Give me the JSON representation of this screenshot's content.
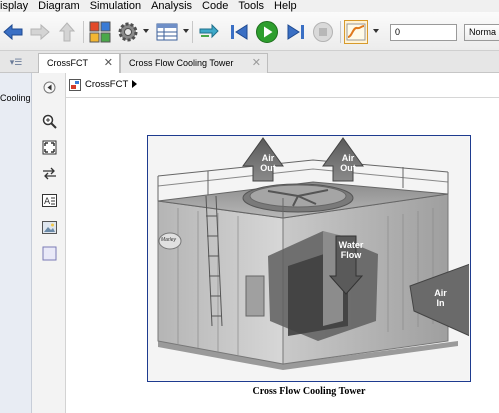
{
  "menu": [
    "isplay",
    "Diagram",
    "Simulation",
    "Analysis",
    "Code",
    "Tools",
    "Help"
  ],
  "toolbar": {
    "stop_time": "0",
    "sim_mode": "Norma",
    "icons": [
      "back-arrow-icon",
      "forward-arrow-icon",
      "up-arrow-icon",
      "library-browser-icon",
      "model-settings-icon",
      "model-explorer-icon",
      "update-diagram-icon",
      "step-back-icon",
      "run-icon",
      "step-forward-icon",
      "stop-icon",
      "data-inspector-icon"
    ]
  },
  "tabs": [
    {
      "label": "CrossFCT",
      "active": true
    },
    {
      "label": "Cross Flow Cooling Tower",
      "active": false
    }
  ],
  "browser": {
    "item": "Cooling"
  },
  "breadcrumb": {
    "model": "CrossFCT"
  },
  "figure": {
    "labels": {
      "air_out_left": [
        "Air",
        "Out"
      ],
      "air_out_right": [
        "Air",
        "Out"
      ],
      "water_flow": [
        "Water",
        "Flow"
      ],
      "air_in": [
        "Air",
        "In"
      ],
      "brand": "Marley"
    },
    "caption": "Cross Flow Cooling Tower"
  },
  "colors": {
    "accent": "#1e3b8f",
    "run_green": "#2e9e2e",
    "nav_blue": "#3a6fc4"
  }
}
